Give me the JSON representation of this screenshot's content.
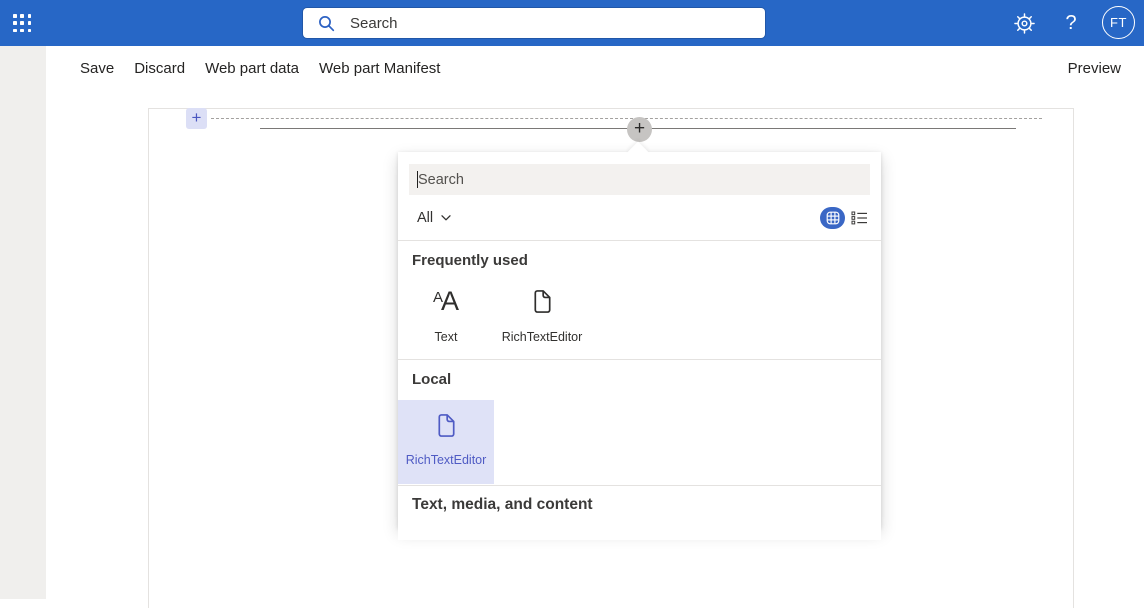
{
  "suitebar": {
    "search_placeholder": "Search",
    "help_label": "?",
    "avatar_initials": "FT"
  },
  "toolbar": {
    "items": [
      "Save",
      "Discard",
      "Web part data",
      "Web part Manifest"
    ],
    "preview": "Preview"
  },
  "canvas": {
    "add_section_label": "+",
    "add_webpart_label": "+"
  },
  "picker": {
    "search_placeholder": "Search",
    "filter": {
      "selected": "All"
    },
    "sections": [
      {
        "title": "Frequently used",
        "items": [
          {
            "label": "Text",
            "icon": "font-icon"
          },
          {
            "label": "RichTextEditor",
            "icon": "page-icon"
          }
        ]
      },
      {
        "title": "Local",
        "items": [
          {
            "label": "RichTextEditor",
            "icon": "page-icon",
            "selected": true
          }
        ]
      }
    ],
    "footer_section": "Text, media, and content"
  },
  "icons": [
    "app-launcher-waffle",
    "search-magnifier",
    "settings-gear",
    "help-question",
    "grid-view",
    "list-view",
    "chevron-down",
    "font-AA",
    "document-page",
    "plus"
  ],
  "colors": {
    "suite_blue": "#2767c6",
    "view_toggle_blue": "#3a67c5",
    "accent_indigo": "#4f5bc4",
    "selected_tile_bg": "#dfe2f7",
    "add_button_bg": "#dcdff6",
    "circle_button_gray": "#c6c4c2",
    "left_rail_gray": "#f0efed"
  }
}
